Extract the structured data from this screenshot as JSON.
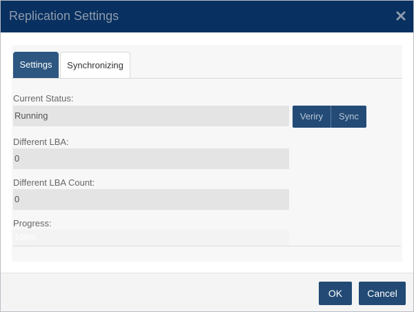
{
  "dialog": {
    "title": "Replication Settings",
    "close_icon": "close-x-icon"
  },
  "tabs": [
    {
      "label": "Settings",
      "active": true
    },
    {
      "label": "Synchronizing",
      "active": false
    }
  ],
  "fields": {
    "current_status": {
      "label": "Current Status:",
      "value": "Running"
    },
    "different_lba": {
      "label": "Different LBA:",
      "value": "0"
    },
    "different_lba_count": {
      "label": "Different LBA Count:",
      "value": "0"
    },
    "progress": {
      "label": "Progress:",
      "value": "100%",
      "percent": 100
    }
  },
  "status_buttons": {
    "verify_label": "Veriry",
    "sync_label": "Sync"
  },
  "footer": {
    "ok_label": "OK",
    "cancel_label": "Cancel"
  },
  "colors": {
    "titlebar_bg": "#083060",
    "primary_button": "#234b76",
    "active_tab": "#2d5680"
  }
}
